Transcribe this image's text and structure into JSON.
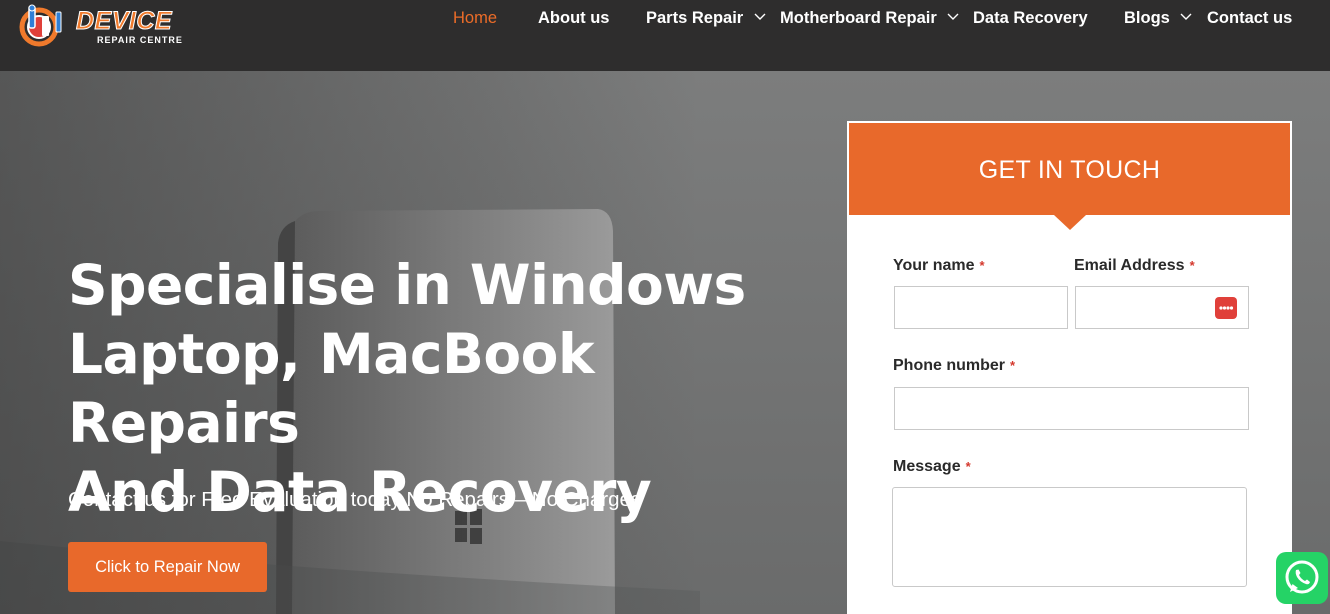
{
  "brand": {
    "name": "DEVICE",
    "tagline": "REPAIR CENTRE",
    "accent": "#e8692b",
    "header_bg": "#2e2d2d"
  },
  "nav": {
    "items": [
      {
        "label": "Home",
        "active": true
      },
      {
        "label": "About us"
      },
      {
        "label": "Parts Repair",
        "dropdown": true
      },
      {
        "label": "Motherboard Repair",
        "dropdown": true
      },
      {
        "label": "Data Recovery"
      },
      {
        "label": "Blogs",
        "dropdown": true
      },
      {
        "label": "Contact us"
      }
    ]
  },
  "hero": {
    "title_line1": "Specialise in Windows",
    "title_line2": "Laptop, MacBook Repairs",
    "title_line3": "And Data Recovery",
    "subtitle": "Contact us for Free Evaluation today No Repairs – No Charges",
    "cta_label": "Click to Repair Now"
  },
  "form": {
    "title": "GET IN TOUCH",
    "required_mark": "*",
    "name_label": "Your name",
    "email_label": "Email Address",
    "phone_label": "Phone number",
    "message_label": "Message",
    "name_value": "",
    "email_value": "",
    "phone_value": "",
    "message_value": ""
  },
  "icons": {
    "password_manager": "password-manager-icon",
    "whatsapp": "whatsapp-icon",
    "chevron": "chevron-down-icon"
  }
}
